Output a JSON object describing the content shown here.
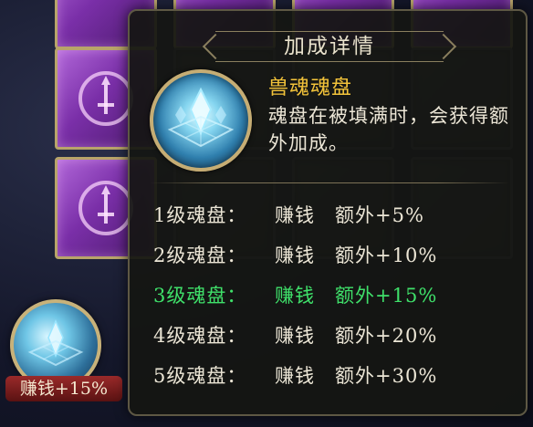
{
  "tooltip": {
    "title": "加成详情",
    "item_name": "兽魂魂盘",
    "item_desc": "魂盘在被填满时，会获得额外加成。",
    "icon": "soul-disc-icon",
    "levels": [
      {
        "name": "1级魂盘：",
        "type": "赚钱",
        "bonus": "额外+5%",
        "active": false
      },
      {
        "name": "2级魂盘：",
        "type": "赚钱",
        "bonus": "额外+10%",
        "active": false
      },
      {
        "name": "3级魂盘：",
        "type": "赚钱",
        "bonus": "额外+15%",
        "active": true
      },
      {
        "name": "4级魂盘：",
        "type": "赚钱",
        "bonus": "额外+20%",
        "active": false
      },
      {
        "name": "5级魂盘：",
        "type": "赚钱",
        "bonus": "额外+30%",
        "active": false
      }
    ]
  },
  "equipped_item": {
    "label": "赚钱+15%",
    "icon": "soul-disc-icon"
  },
  "colors": {
    "item_name": "#f3c33a",
    "active_level": "#3fe06a",
    "slot_purple": "#7a2fa8"
  }
}
